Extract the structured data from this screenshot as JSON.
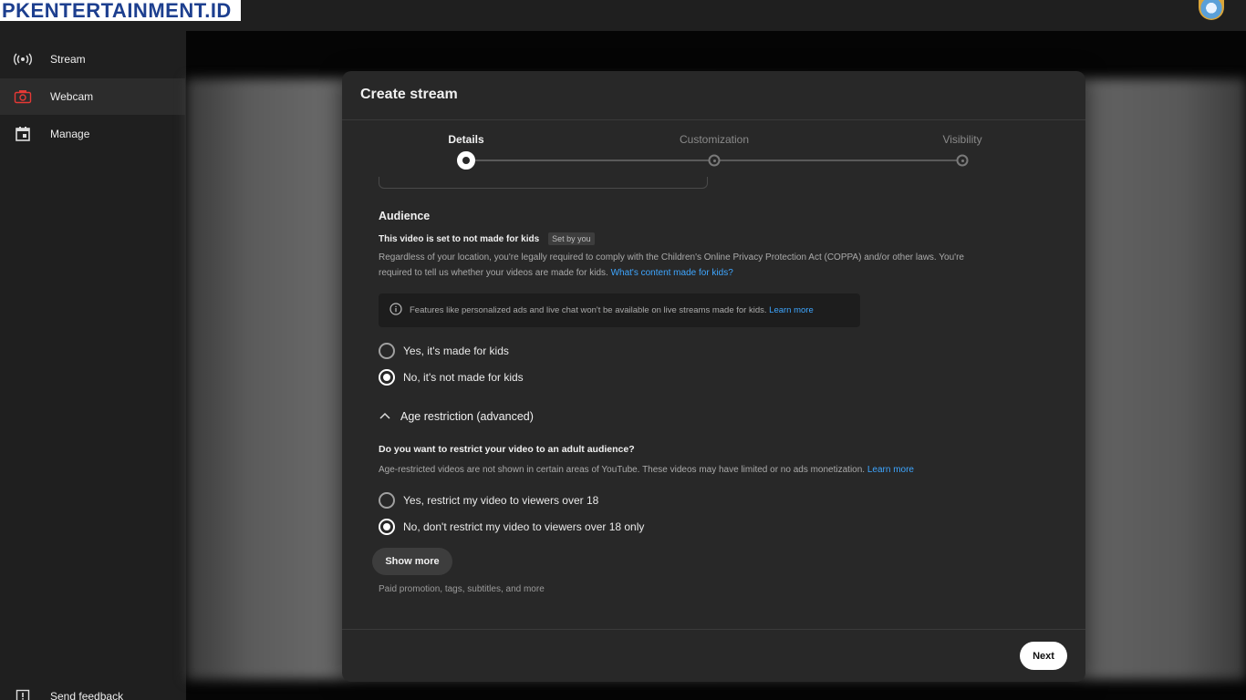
{
  "watermark": {
    "text": "PKENTERTAINMENT.ID"
  },
  "sidebar": {
    "items": [
      {
        "label": "Stream",
        "icon": "broadcast-icon"
      },
      {
        "label": "Webcam",
        "icon": "camera-icon",
        "active": true
      },
      {
        "label": "Manage",
        "icon": "calendar-icon"
      }
    ],
    "feedback": {
      "label": "Send feedback",
      "icon": "feedback-icon"
    }
  },
  "dialog": {
    "title": "Create stream",
    "steps": [
      {
        "label": "Details",
        "state": "active"
      },
      {
        "label": "Customization",
        "state": "inactive"
      },
      {
        "label": "Visibility",
        "state": "inactive"
      }
    ],
    "audience": {
      "heading": "Audience",
      "status": "This video is set to not made for kids",
      "badge": "Set by you",
      "paragraph_line1": "Regardless of your location, you're legally required to comply with the Children's Online Privacy Protection Act (COPPA) and/or other laws. You're",
      "paragraph_line2": "required to tell us whether your videos are made for kids.",
      "paragraph_link": "What's content made for kids?",
      "info_text": "Features like personalized ads and live chat won't be available on live streams made for kids.",
      "info_link": "Learn more",
      "options": [
        {
          "label": "Yes, it's made for kids",
          "selected": false
        },
        {
          "label": "No, it's not made for kids",
          "selected": true
        }
      ]
    },
    "age_restriction": {
      "toggle_label": "Age restriction (advanced)",
      "question": "Do you want to restrict your video to an adult audience?",
      "description": "Age-restricted videos are not shown in certain areas of YouTube. These videos may have limited or no ads monetization.",
      "description_link": "Learn more",
      "options": [
        {
          "label": "Yes, restrict my video to viewers over 18",
          "selected": false
        },
        {
          "label": "No, don't restrict my video to viewers over 18 only",
          "selected": true
        }
      ]
    },
    "show_more": {
      "label": "Show more",
      "note": "Paid promotion, tags, subtitles, and more"
    },
    "next_label": "Next"
  },
  "colors": {
    "accent_link": "#3ea6ff",
    "dialog_bg": "#282828",
    "sidebar_bg": "#1f1f1f",
    "webcam_icon": "#e53935"
  }
}
